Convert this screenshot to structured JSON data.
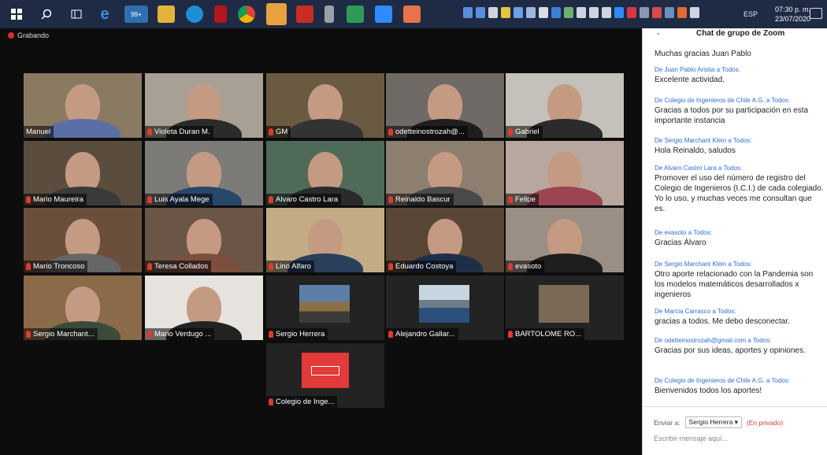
{
  "taskbar": {
    "tray_lang": "ESP",
    "clock_time": "07:30 p. m.",
    "clock_date": "23/07/2020",
    "badge_count": "99+"
  },
  "gallery": {
    "recording_label": "Grabando",
    "tiles": [
      {
        "name": "Manuel",
        "shirt": "#5b6fa6",
        "bg": "#8a7a62"
      },
      {
        "name": "Violeta Duran M.",
        "shirt": "#2b2b2b",
        "bg": "#a89f95"
      },
      {
        "name": "GM",
        "shirt": "#333333",
        "bg": "#6b5a42"
      },
      {
        "name": "odetteinostrozah@...",
        "shirt": "#1f1f1f",
        "bg": "#6f6a66"
      },
      {
        "name": "Gabriel",
        "shirt": "#2b2b2b",
        "bg": "#c4c0ba"
      },
      {
        "name": "Mario Maureira",
        "shirt": "#3a3a3a",
        "bg": "#5a4d3e"
      },
      {
        "name": "Luis Ayala Mege",
        "shirt": "#27476b",
        "bg": "#7d7b78"
      },
      {
        "name": "Alvaro Castro Lara",
        "shirt": "#2b2b2b",
        "bg": "#4f6b57"
      },
      {
        "name": "Reinaldo Bascur",
        "shirt": "#4a4a4a",
        "bg": "#8d7f70"
      },
      {
        "name": "Felipe",
        "shirt": "#9b4552",
        "bg": "#b8a79e"
      },
      {
        "name": "Mario Troncoso",
        "shirt": "#666666",
        "bg": "#6b4f3d"
      },
      {
        "name": "Teresa Collados",
        "shirt": "#7d4f3f",
        "bg": "#6a5546"
      },
      {
        "name": "Lino Alfaro",
        "shirt": "#2a3f5c",
        "bg": "#c3ab85"
      },
      {
        "name": "Eduardo Costoya",
        "shirt": "#1f2f4a",
        "bg": "#5a4637"
      },
      {
        "name": "evasoto",
        "shirt": "#1e1e1e",
        "bg": "#9a8e85"
      },
      {
        "name": "Sergio Marchant...",
        "shirt": "#3b4a3a",
        "bg": "#8a6a48"
      },
      {
        "name": "Mario Verdugo ...",
        "shirt": "#222222",
        "bg": "#e6e3de"
      }
    ],
    "photo_tiles": [
      {
        "name": "Sergio Herrera"
      },
      {
        "name": "Alejandro Gallar..."
      },
      {
        "name": "BARTOLOME RO..."
      },
      {
        "name": "Colegio de Inge..."
      }
    ]
  },
  "chat": {
    "title": "Chat de grupo de Zoom",
    "messages": [
      {
        "from": "",
        "text": "Muchas gracias Juan Pablo"
      },
      {
        "from": "De Juan Pablo Aristia a Todos:",
        "text": "Excelente actividad."
      },
      {
        "from": "De Colegio de Ingenieros de Chile A.G. a Todos:",
        "text": "Gracias a todos por su participación en esta importante instancia"
      },
      {
        "from": "De Sergio Marchant Klein a Todos:",
        "text": "Hola Reinaldo, saludos"
      },
      {
        "from": "De Alvaro Castro Lara a Todos:",
        "text": "Promover el uso del número de registro del Colegio de Ingenieros (I.C.I.) de cada colegiado. Yo lo uso, y muchas veces me consultan que es."
      },
      {
        "from": "De evasoto a Todos:",
        "text": "Gracias Álvaro"
      },
      {
        "from": "De Sergio Marchant Klein a Todos:",
        "text": "Otro aporte relacionado con la Pandemia son los modelos matemáticos desarrollados x ingenieros"
      },
      {
        "from": "De Marcia Carrasco a Todos:",
        "text": "gracias a todos.  Me debo desconectar."
      },
      {
        "from": "De odetteinostrozah@gmail.com a Todos:",
        "text": "Gracias por sus ideas, aportes y opiniones."
      },
      {
        "from": "De Colegio de Ingenieros de Chile A.G. a Todos:",
        "text": "Bienvenidos todos los aportes!"
      }
    ],
    "send_to_label": "Enviar a:",
    "recipient": "Sergio Herrera ▾",
    "private_label": "(En privado)",
    "input_placeholder": "Escribir mensaje aquí..."
  }
}
